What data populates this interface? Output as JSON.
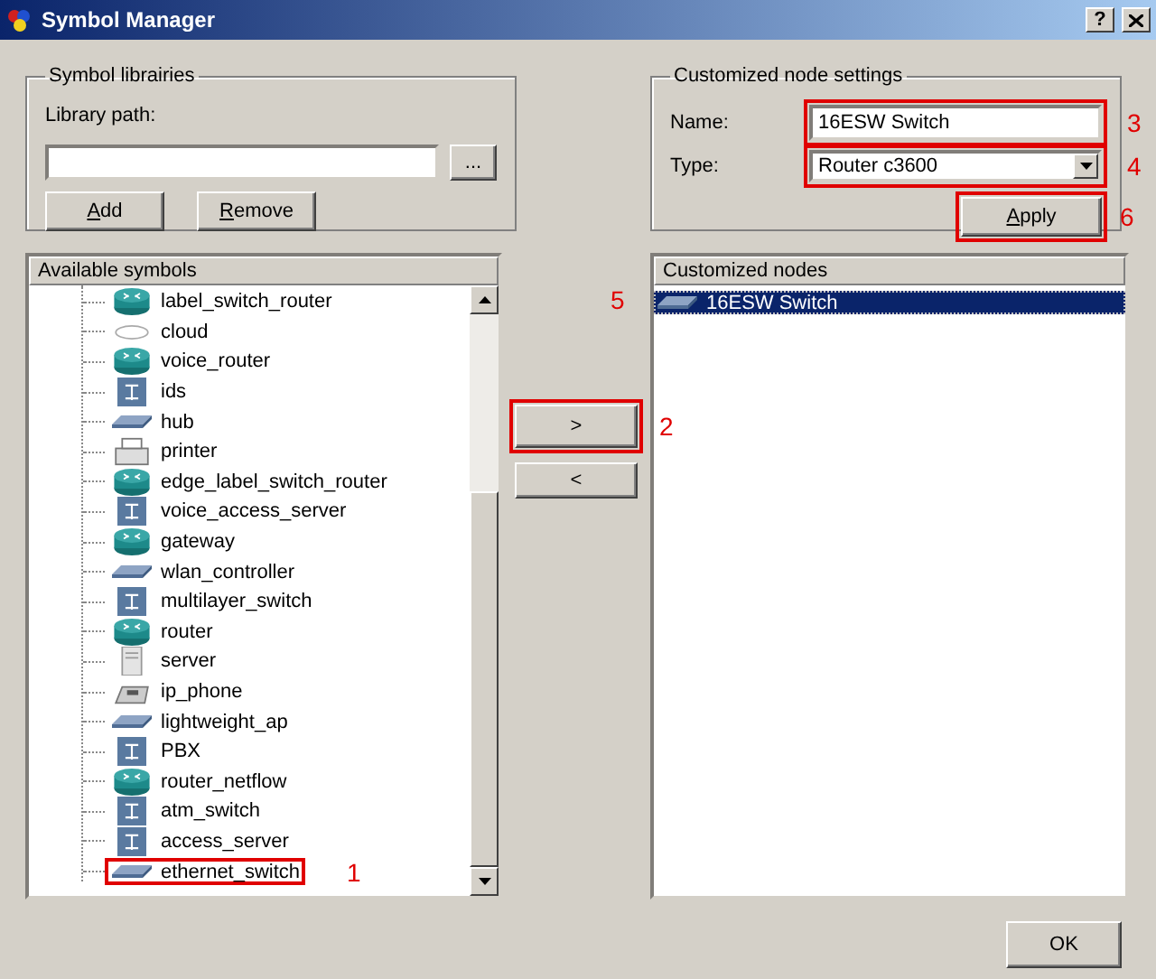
{
  "window": {
    "title": "Symbol Manager",
    "help_button": "?"
  },
  "symbol_libraries": {
    "title": "Symbol librairies",
    "path_label": "Library path:",
    "browse_button": "...",
    "buttons": [
      {
        "label": "Add"
      },
      {
        "label": "Remove"
      }
    ]
  },
  "node_settings": {
    "title": "Customized node settings",
    "name_label": "Name:",
    "name_value": "16ESW Switch",
    "name_highlighted": true,
    "name_callout": "3",
    "type_label": "Type:",
    "type_value": "Router c3600",
    "type_highlighted": true,
    "type_callout": "4",
    "apply_button": "Apply",
    "apply_highlighted": true,
    "apply_callout": "6"
  },
  "available_symbols": {
    "header": "Available symbols",
    "items": [
      {
        "label": "label_switch_router",
        "kind": "router",
        "highlighted": false
      },
      {
        "label": "cloud",
        "kind": "cloud",
        "highlighted": false
      },
      {
        "label": "voice_router",
        "kind": "router",
        "highlighted": false
      },
      {
        "label": "ids",
        "kind": "tile",
        "highlighted": false
      },
      {
        "label": "hub",
        "kind": "slab",
        "highlighted": false
      },
      {
        "label": "printer",
        "kind": "printer",
        "highlighted": false
      },
      {
        "label": "edge_label_switch_router",
        "kind": "router",
        "highlighted": false
      },
      {
        "label": "voice_access_server",
        "kind": "tile",
        "highlighted": false
      },
      {
        "label": "gateway",
        "kind": "router",
        "highlighted": false
      },
      {
        "label": "wlan_controller",
        "kind": "slab",
        "highlighted": false
      },
      {
        "label": "multilayer_switch",
        "kind": "tile",
        "highlighted": false
      },
      {
        "label": "router",
        "kind": "router",
        "highlighted": false
      },
      {
        "label": "server",
        "kind": "server",
        "highlighted": false
      },
      {
        "label": "ip_phone",
        "kind": "phone",
        "highlighted": false
      },
      {
        "label": "lightweight_ap",
        "kind": "slab",
        "highlighted": false
      },
      {
        "label": "PBX",
        "kind": "tile",
        "highlighted": false
      },
      {
        "label": "router_netflow",
        "kind": "router",
        "highlighted": false
      },
      {
        "label": "atm_switch",
        "kind": "tile",
        "highlighted": false
      },
      {
        "label": "access_server",
        "kind": "tile",
        "highlighted": false
      },
      {
        "label": "ethernet_switch",
        "kind": "slab",
        "highlighted": true,
        "callout": "1"
      }
    ]
  },
  "transfer_buttons": [
    {
      "label": ">",
      "highlighted": true,
      "callout": "2"
    },
    {
      "label": "<",
      "highlighted": false
    }
  ],
  "customized_nodes": {
    "header": "Customized nodes",
    "callout": "5",
    "items": [
      {
        "label": "16ESW Switch",
        "kind": "slab",
        "selected": true
      }
    ]
  },
  "ok_button": "OK"
}
